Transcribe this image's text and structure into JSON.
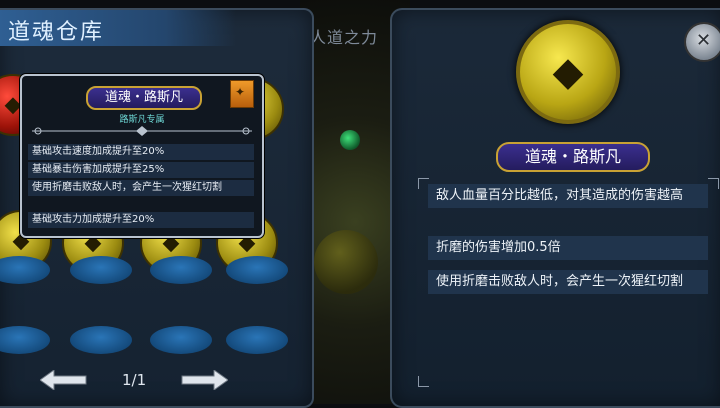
{
  "left_panel": {
    "title": "道魂仓库",
    "pager": {
      "text": "1/1"
    }
  },
  "middle": {
    "title_partial": "人道之力"
  },
  "tooltip": {
    "name": "道魂・路斯凡",
    "subtitle": "路斯凡专属",
    "effects": [
      "基础攻击速度加成提升至20%",
      "基础暴击伤害加成提升至25%",
      "使用折磨击败敌人时，会产生一次猩红切割",
      "基础攻击力加成提升至20%"
    ]
  },
  "detail": {
    "name": "道魂・路斯凡",
    "descriptions": [
      "敌人血量百分比越低，对其造成的伤害越高",
      "折磨的伤害增加0.5倍",
      "使用折磨击败敌人时，会产生一次猩红切割"
    ]
  },
  "colors": {
    "gold": "#c9a234",
    "panel": "#1b2939",
    "slot_blue": "#2a75b7"
  }
}
